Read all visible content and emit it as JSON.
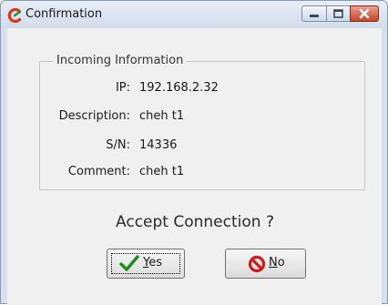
{
  "window": {
    "title": "Confirmation",
    "icon": "app-icon"
  },
  "group": {
    "title": "Incoming Information",
    "fields": [
      {
        "label": "IP:",
        "value": "192.168.2.32"
      },
      {
        "label": "Description:",
        "value": "cheh t1"
      },
      {
        "label": "S/N:",
        "value": "14336"
      },
      {
        "label": "Comment:",
        "value": "cheh t1"
      }
    ]
  },
  "prompt": "Accept Connection ?",
  "buttons": {
    "yes": {
      "mnemonic": "Y",
      "rest": "es",
      "icon": "checkmark-icon"
    },
    "no": {
      "mnemonic": "N",
      "rest": "o",
      "icon": "no-entry-icon"
    }
  },
  "colors": {
    "check": "#1f8a1f",
    "no_icon": "#d01b1b",
    "close_button": "#c4452b"
  }
}
